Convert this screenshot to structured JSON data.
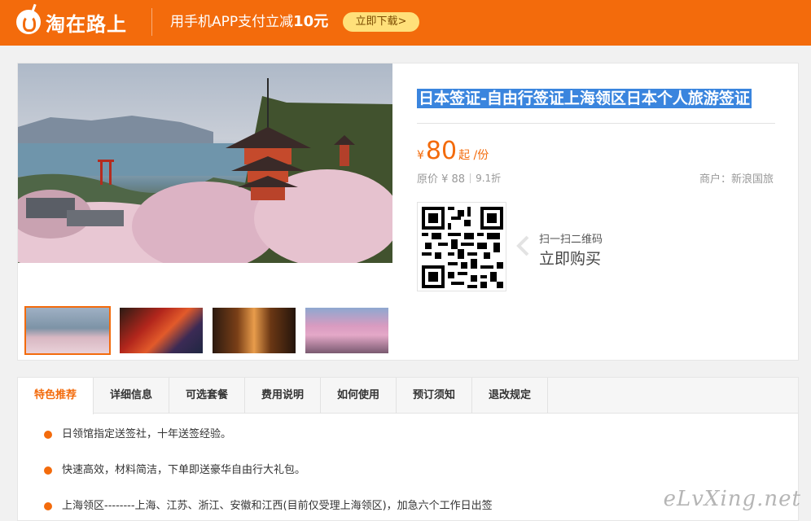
{
  "header": {
    "logo_text": "淘在路上",
    "promo_prefix": "用手机APP支付立减",
    "promo_amount": "10元",
    "download_label": "立即下载>"
  },
  "product": {
    "title": "日本签证-自由行签证上海领区日本个人旅游签证",
    "currency": "¥",
    "price": "80",
    "price_unit": "起 /份",
    "original_price": "原价 ¥ 88",
    "discount": "9.1折",
    "merchant": "商户：新浪国旅",
    "scan_hint": "扫一扫二维码",
    "buy_label": "立即购买",
    "thumbnails": [
      "thumb-1",
      "thumb-2",
      "thumb-3",
      "thumb-4"
    ]
  },
  "tabs": [
    "特色推荐",
    "详细信息",
    "可选套餐",
    "费用说明",
    "如何使用",
    "预订须知",
    "退改规定"
  ],
  "features": [
    "日领馆指定送签社，十年送签经验。",
    "快速高效，材料简洁，下单即送豪华自由行大礼包。",
    "上海领区--------上海、江苏、浙江、安徽和江西(目前仅受理上海领区)，加急六个工作日出签"
  ],
  "watermark": "eLvXing.net",
  "colors": {
    "brand": "#f36b0c",
    "title_highlight": "#3a85de",
    "download_button": "#ffe07a"
  }
}
